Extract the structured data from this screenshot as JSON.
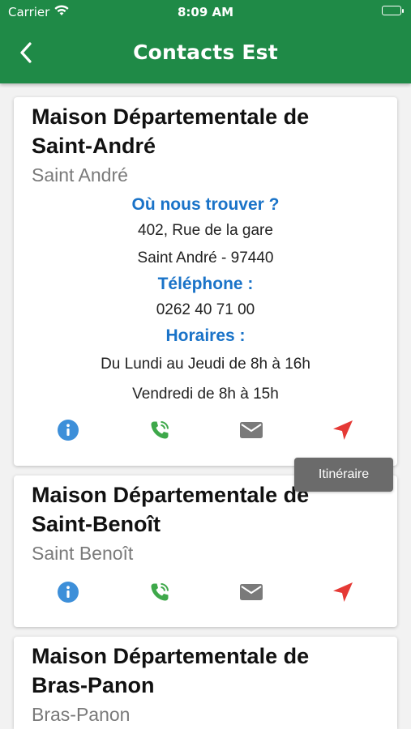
{
  "status_bar": {
    "carrier": "Carrier",
    "time": "8:09 AM"
  },
  "header": {
    "title": "Contacts Est"
  },
  "labels": {
    "where": "Où nous trouver ?",
    "phone": "Téléphone :",
    "hours": "Horaires :"
  },
  "cards": [
    {
      "title_line1": "Maison Départementale de",
      "title_line2": "Saint-André",
      "subtitle": "Saint André",
      "address1": "402, Rue de la gare",
      "address2": "Saint André - 97440",
      "phone": "0262 40 71 00",
      "hours1": "Du Lundi au Jeudi de 8h à 16h",
      "hours2": "Vendredi de 8h à 15h"
    },
    {
      "title_line1": "Maison Départementale de",
      "title_line2": "Saint-Benoît",
      "subtitle": "Saint Benoît"
    },
    {
      "title_line1": "Maison Départementale de",
      "title_line2": "Bras-Panon",
      "subtitle": "Bras-Panon"
    }
  ],
  "tooltip": {
    "text": "Itinéraire"
  },
  "icons": {
    "info": "info-icon",
    "phone": "phone-call-icon",
    "mail": "mail-icon",
    "directions": "navigation-arrow-icon"
  },
  "colors": {
    "header": "#1f8a47",
    "info": "#3d8fd9",
    "phone": "#3ea84a",
    "mail": "#7a7a7a",
    "directions": "#e53935",
    "section_heading": "#1a73c8"
  }
}
